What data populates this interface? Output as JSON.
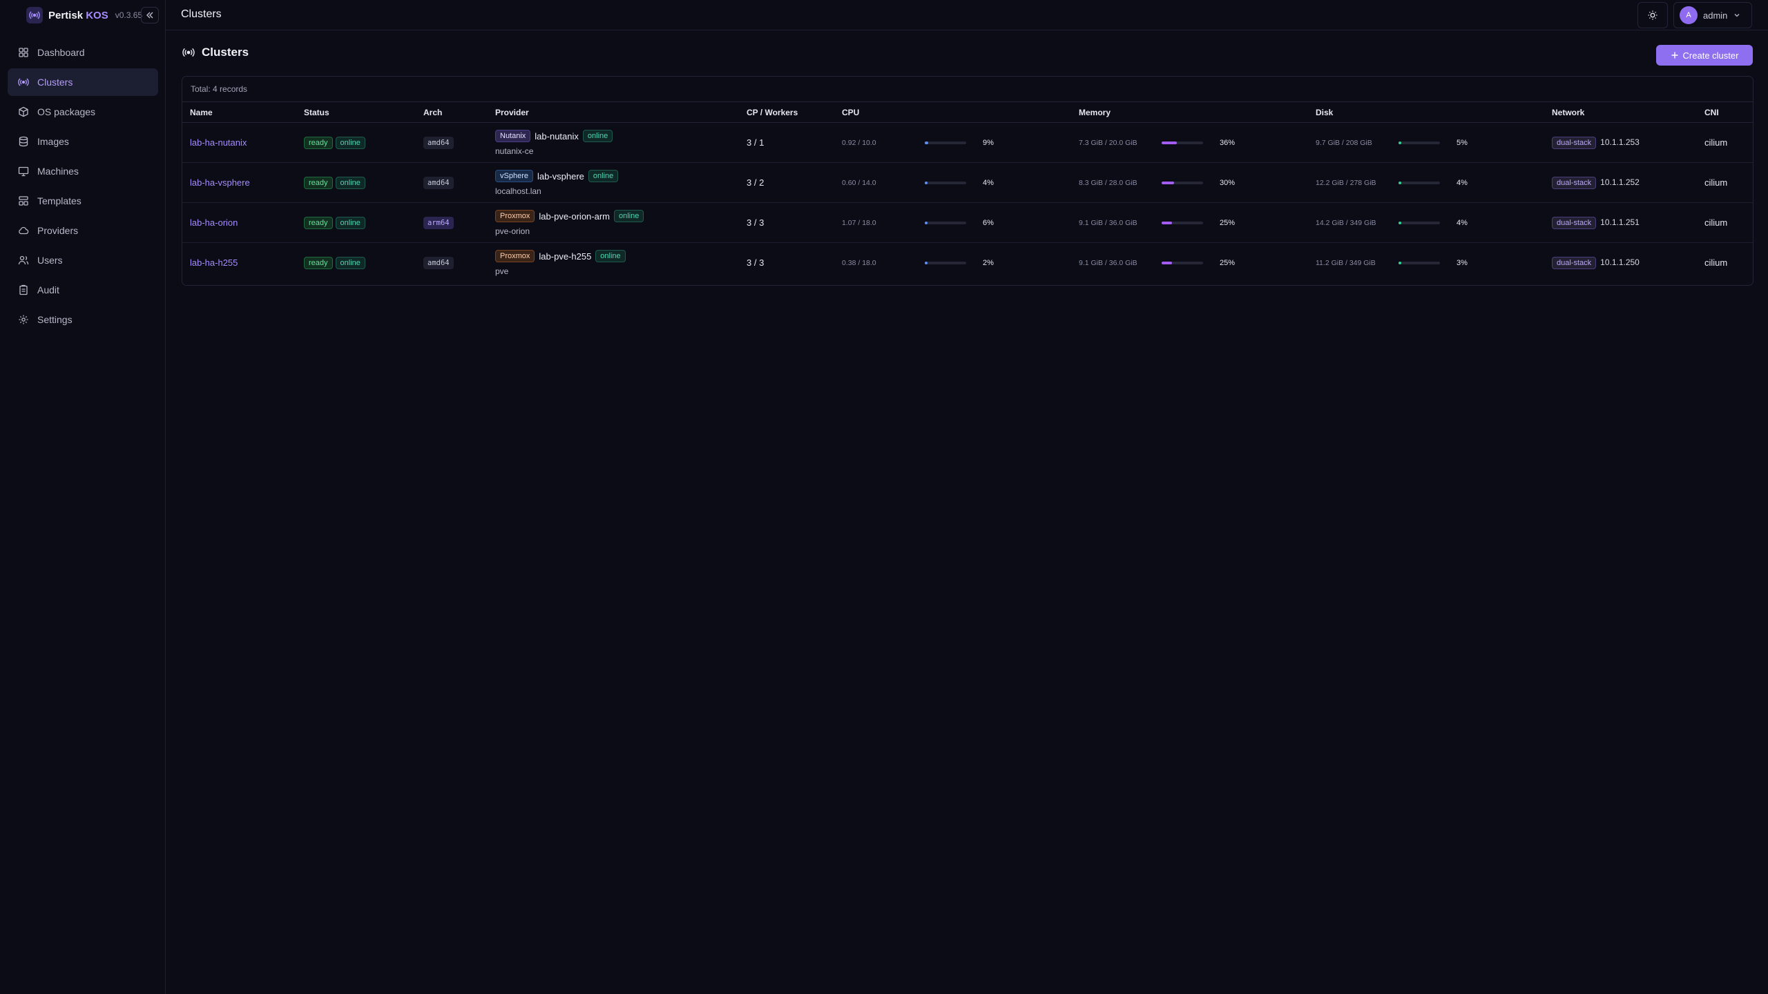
{
  "app": {
    "name": "Pertisk",
    "accent": "KOS",
    "version": "v0.3.65"
  },
  "sidebar": {
    "items": [
      {
        "label": "Dashboard",
        "icon": "dashboard-icon"
      },
      {
        "label": "Clusters",
        "icon": "clusters-icon",
        "active": true
      },
      {
        "label": "OS packages",
        "icon": "package-icon"
      },
      {
        "label": "Images",
        "icon": "database-icon"
      },
      {
        "label": "Machines",
        "icon": "monitor-icon"
      },
      {
        "label": "Templates",
        "icon": "templates-icon"
      },
      {
        "label": "Providers",
        "icon": "cloud-icon"
      },
      {
        "label": "Users",
        "icon": "users-icon"
      },
      {
        "label": "Audit",
        "icon": "clipboard-icon"
      },
      {
        "label": "Settings",
        "icon": "gear-icon"
      }
    ]
  },
  "header": {
    "title": "Clusters",
    "user": {
      "initial": "A",
      "name": "admin"
    }
  },
  "page": {
    "title": "Clusters",
    "create_label": "Create cluster",
    "total": "Total: 4 records"
  },
  "table": {
    "columns": [
      "Name",
      "Status",
      "Arch",
      "Provider",
      "CP / Workers",
      "CPU",
      "Memory",
      "Disk",
      "Network",
      "CNI"
    ],
    "rows": [
      {
        "name": "lab-ha-nutanix",
        "status": "ready",
        "state": "online",
        "arch": "amd64",
        "provider_type": "Nutanix",
        "provider_name": "lab-nutanix",
        "provider_state": "online",
        "provider_host": "nutanix-ce",
        "cp_workers": "3 / 1",
        "cpu": "0.92 / 10.0",
        "cpu_pct": "9%",
        "cpu_frac": 0.09,
        "mem": "7.3 GiB / 20.0 GiB",
        "mem_pct": "36%",
        "mem_frac": 0.36,
        "disk": "9.7 GiB / 208 GiB",
        "disk_pct": "5%",
        "disk_frac": 0.05,
        "network": "dual-stack",
        "ip": "10.1.1.253",
        "cni": "cilium"
      },
      {
        "name": "lab-ha-vsphere",
        "status": "ready",
        "state": "online",
        "arch": "amd64",
        "provider_type": "vSphere",
        "provider_name": "lab-vsphere",
        "provider_state": "online",
        "provider_host": "localhost.lan",
        "cp_workers": "3 / 2",
        "cpu": "0.60 / 14.0",
        "cpu_pct": "4%",
        "cpu_frac": 0.04,
        "mem": "8.3 GiB / 28.0 GiB",
        "mem_pct": "30%",
        "mem_frac": 0.3,
        "disk": "12.2 GiB / 278 GiB",
        "disk_pct": "4%",
        "disk_frac": 0.04,
        "network": "dual-stack",
        "ip": "10.1.1.252",
        "cni": "cilium"
      },
      {
        "name": "lab-ha-orion",
        "status": "ready",
        "state": "online",
        "arch": "arm64",
        "provider_type": "Proxmox",
        "provider_name": "lab-pve-orion-arm",
        "provider_state": "online",
        "provider_host": "pve-orion",
        "cp_workers": "3 / 3",
        "cpu": "1.07 / 18.0",
        "cpu_pct": "6%",
        "cpu_frac": 0.06,
        "mem": "9.1 GiB / 36.0 GiB",
        "mem_pct": "25%",
        "mem_frac": 0.25,
        "disk": "14.2 GiB / 349 GiB",
        "disk_pct": "4%",
        "disk_frac": 0.04,
        "network": "dual-stack",
        "ip": "10.1.1.251",
        "cni": "cilium"
      },
      {
        "name": "lab-ha-h255",
        "status": "ready",
        "state": "online",
        "arch": "amd64",
        "provider_type": "Proxmox",
        "provider_name": "lab-pve-h255",
        "provider_state": "online",
        "provider_host": "pve",
        "cp_workers": "3 / 3",
        "cpu": "0.38 / 18.0",
        "cpu_pct": "2%",
        "cpu_frac": 0.02,
        "mem": "9.1 GiB / 36.0 GiB",
        "mem_pct": "25%",
        "mem_frac": 0.25,
        "disk": "11.2 GiB / 349 GiB",
        "disk_pct": "3%",
        "disk_frac": 0.03,
        "network": "dual-stack",
        "ip": "10.1.1.250",
        "cni": "cilium"
      }
    ]
  }
}
